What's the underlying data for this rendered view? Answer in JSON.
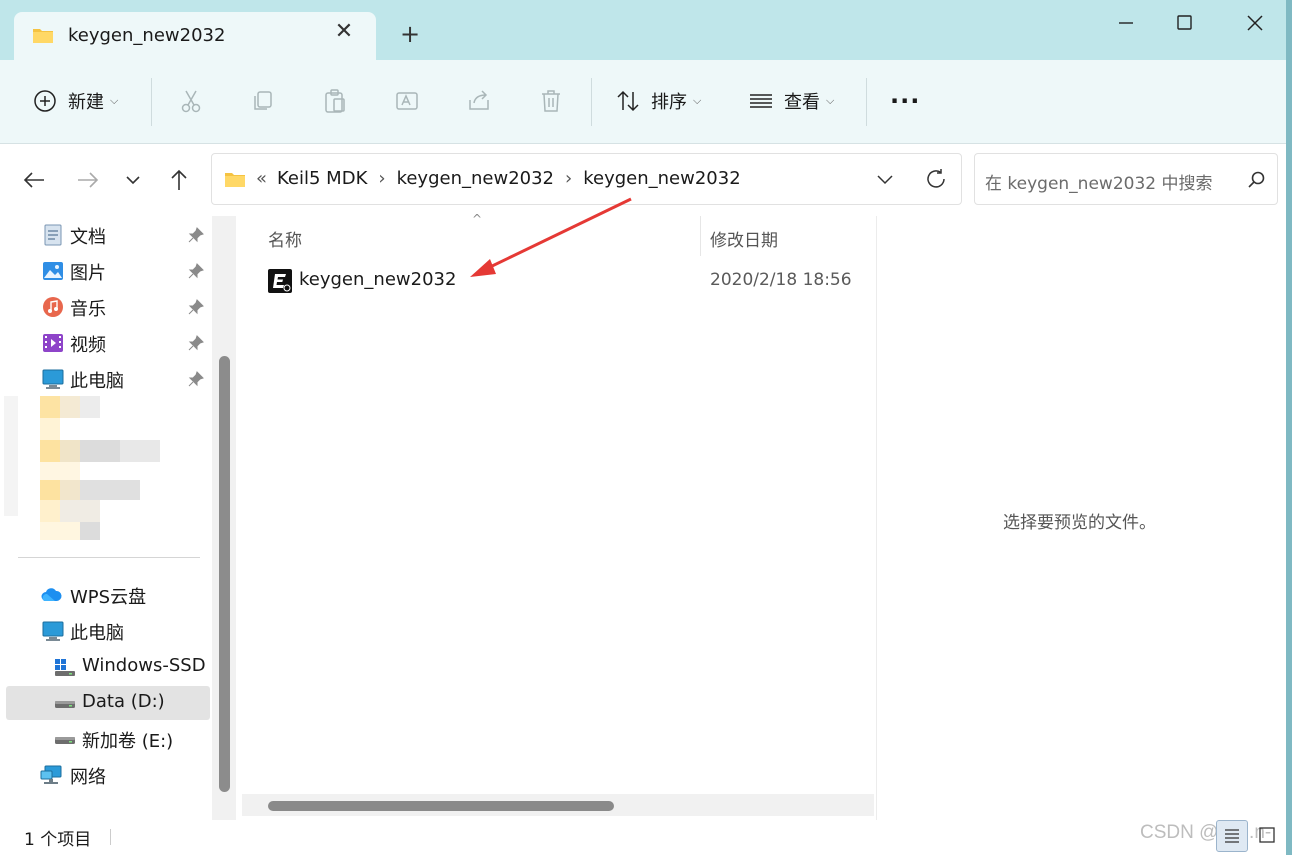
{
  "tab": {
    "title": "keygen_new2032",
    "close_glyph": "✕",
    "add_glyph": "+"
  },
  "toolbar": {
    "new_label": "新建",
    "sort_label": "排序",
    "view_label": "查看",
    "more_glyph": "···",
    "chevron": "⌵"
  },
  "address": {
    "overflow": "«",
    "crumbs": [
      "Keil5 MDK",
      "keygen_new2032",
      "keygen_new2032"
    ],
    "separator": "›"
  },
  "search": {
    "placeholder": "在 keygen_new2032 中搜索"
  },
  "sidebar": {
    "quick_access": [
      {
        "label": "文档",
        "icon": "documents-icon"
      },
      {
        "label": "图片",
        "icon": "pictures-icon"
      },
      {
        "label": "音乐",
        "icon": "music-icon"
      },
      {
        "label": "视频",
        "icon": "videos-icon"
      },
      {
        "label": "此电脑",
        "icon": "computer-icon"
      }
    ],
    "locations": [
      {
        "label": "WPS云盘",
        "icon": "cloud-icon"
      },
      {
        "label": "此电脑",
        "icon": "computer-icon"
      },
      {
        "label": "Windows-SSD (",
        "icon": "windows-drive-icon"
      },
      {
        "label": "Data (D:)",
        "icon": "drive-icon",
        "selected": true
      },
      {
        "label": "新加卷 (E:)",
        "icon": "drive-icon"
      },
      {
        "label": "网络",
        "icon": "network-icon"
      }
    ]
  },
  "columns": {
    "name": "名称",
    "modified": "修改日期"
  },
  "files": [
    {
      "name": "keygen_new2032",
      "modified": "2020/2/18 18:56",
      "icon": "keygen-app-icon"
    }
  ],
  "preview": {
    "empty_text": "选择要预览的文件。"
  },
  "status": {
    "item_count": "1 个项目"
  },
  "watermark": "CSDN @lea..n-",
  "colors": {
    "titlebar": "#bfe6ea",
    "toolbar": "#eef8f9",
    "annotation_arrow": "#e53935",
    "selected": "#e3e3e3"
  }
}
